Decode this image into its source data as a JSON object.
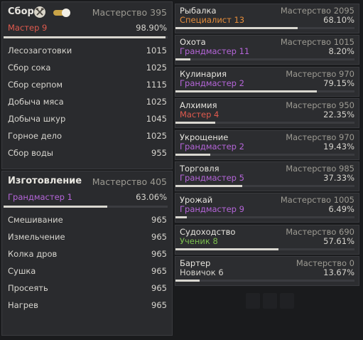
{
  "colors": {
    "master": "#e05a4e",
    "grandmaster": "#b565d9",
    "specialist": "#e48c3a",
    "student": "#7bbf4e",
    "novice": "#d6d4ce"
  },
  "gathering": {
    "title": "Сбор",
    "mastery": "Мастерство 395",
    "rank": "Мастер 9",
    "rank_tier": "master",
    "percent": "98.90%",
    "progress": 0.989,
    "toggle_on": true,
    "emblem_icon": "crossed-tools-icon",
    "skills": [
      {
        "name": "Лесозаготовки",
        "value": "1015"
      },
      {
        "name": "Сбор сока",
        "value": "1025"
      },
      {
        "name": "Сбор серпом",
        "value": "1115"
      },
      {
        "name": "Добыча мяса",
        "value": "1025"
      },
      {
        "name": "Добыча шкур",
        "value": "1045"
      },
      {
        "name": "Горное дело",
        "value": "1025"
      },
      {
        "name": "Сбор воды",
        "value": "955"
      }
    ]
  },
  "crafting": {
    "title": "Изготовление",
    "mastery": "Мастерство 405",
    "rank": "Грандмастер 1",
    "rank_tier": "grandmaster",
    "percent": "63.06%",
    "progress": 0.6306,
    "skills": [
      {
        "name": "Смешивание",
        "value": "965"
      },
      {
        "name": "Измельчение",
        "value": "965"
      },
      {
        "name": "Колка дров",
        "value": "965"
      },
      {
        "name": "Сушка",
        "value": "965"
      },
      {
        "name": "Просеять",
        "value": "965"
      },
      {
        "name": "Нагрев",
        "value": "965"
      }
    ]
  },
  "life_skills": [
    {
      "name": "Рыбалка",
      "mastery": "Мастерство 2095",
      "rank": "Специалист 13",
      "tier": "specialist",
      "percent": "68.10%",
      "progress": 0.681
    },
    {
      "name": "Охота",
      "mastery": "Мастерство 1015",
      "rank": "Грандмастер 11",
      "tier": "grandmaster",
      "percent": "8.20%",
      "progress": 0.082
    },
    {
      "name": "Кулинария",
      "mastery": "Мастерство 970",
      "rank": "Грандмастер 2",
      "tier": "grandmaster",
      "percent": "79.15%",
      "progress": 0.7915
    },
    {
      "name": "Алхимия",
      "mastery": "Мастерство 950",
      "rank": "Мастер 4",
      "tier": "master",
      "percent": "22.35%",
      "progress": 0.2235
    },
    {
      "name": "Укрощение",
      "mastery": "Мастерство 970",
      "rank": "Грандмастер 2",
      "tier": "grandmaster",
      "percent": "19.43%",
      "progress": 0.1943
    },
    {
      "name": "Торговля",
      "mastery": "Мастерство 985",
      "rank": "Грандмастер 5",
      "tier": "grandmaster",
      "percent": "37.33%",
      "progress": 0.3733
    },
    {
      "name": "Урожай",
      "mastery": "Мастерство 1005",
      "rank": "Грандмастер 9",
      "tier": "grandmaster",
      "percent": "6.49%",
      "progress": 0.0649
    },
    {
      "name": "Судоходство",
      "mastery": "Мастерство 690",
      "rank": "Ученик 8",
      "tier": "student",
      "percent": "57.61%",
      "progress": 0.5761
    },
    {
      "name": "Бартер",
      "mastery": "Мастерство 0",
      "rank": "Новичок 6",
      "tier": "novice",
      "percent": "13.67%",
      "progress": 0.1367
    }
  ]
}
